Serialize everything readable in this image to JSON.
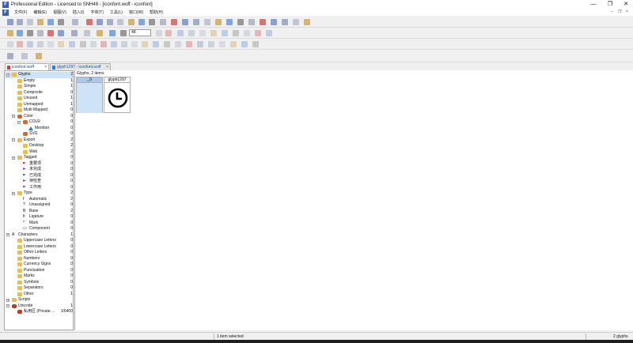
{
  "window": {
    "title": "Professional Edition - Licensed to SNH48 - [iconfont.woff - iconfont]",
    "minimize": "—",
    "maximize": "❐",
    "close": "✕"
  },
  "menubar": {
    "items": [
      "文件(F)",
      "编辑(E)",
      "视图(V)",
      "插入(I)",
      "字体(T)",
      "工具(L)",
      "窗口(W)",
      "帮助(H)"
    ],
    "mdi_controls": [
      "–",
      "❐",
      "×"
    ]
  },
  "toolbar": {
    "zoom_value": "48"
  },
  "tabs": [
    {
      "label": "iconfont.woff",
      "active": true
    },
    {
      "label": "glyph1297 - iconfont.woff",
      "active": false
    }
  ],
  "tree": {
    "items": [
      {
        "label": "Glyphs",
        "count": "2",
        "level": 0,
        "expander": "−",
        "icon": "folder",
        "selected": true
      },
      {
        "label": "Empty",
        "count": "1",
        "level": 1,
        "icon": "folder"
      },
      {
        "label": "Simple",
        "count": "1",
        "level": 1,
        "icon": "folder"
      },
      {
        "label": "Composite",
        "count": "0",
        "level": 1,
        "icon": "folder"
      },
      {
        "label": "Unused",
        "count": "1",
        "level": 1,
        "icon": "folder"
      },
      {
        "label": "Unmapped",
        "count": "1",
        "level": 1,
        "icon": "folder"
      },
      {
        "label": "Multi Mapped",
        "count": "0",
        "level": 1,
        "icon": "folder"
      },
      {
        "label": "Color",
        "count": "0",
        "level": 1,
        "expander": "−",
        "icon": "color"
      },
      {
        "label": "COLR",
        "count": "0",
        "level": 2,
        "expander": "−",
        "icon": "color"
      },
      {
        "label": "Member",
        "count": "0",
        "level": 3,
        "icon": "triangle"
      },
      {
        "label": "SVG",
        "count": "0",
        "level": 2,
        "icon": "color"
      },
      {
        "label": "Export",
        "count": "2",
        "level": 1,
        "expander": "−",
        "icon": "folder"
      },
      {
        "label": "Desktop",
        "count": "2",
        "level": 2,
        "icon": "folder"
      },
      {
        "label": "Web",
        "count": "2",
        "level": 2,
        "icon": "folder"
      },
      {
        "label": "Tagged",
        "count": "0",
        "level": 1,
        "expander": "−",
        "icon": "folder"
      },
      {
        "label": "重要项",
        "count": "0",
        "level": 2,
        "icon": "flag-red"
      },
      {
        "label": "未完成",
        "count": "0",
        "level": 2,
        "icon": "flag-purple"
      },
      {
        "label": "已完成",
        "count": "0",
        "level": 2,
        "icon": "flag-blue"
      },
      {
        "label": "待检查",
        "count": "0",
        "level": 2,
        "icon": "flag-purple"
      },
      {
        "label": "工作用",
        "count": "0",
        "level": 2,
        "icon": "flag-blue"
      },
      {
        "label": "Type",
        "count": "2",
        "level": 1,
        "expander": "−",
        "icon": "folder"
      },
      {
        "label": "Automatic",
        "count": "2",
        "level": 2,
        "icon": "glyph-f"
      },
      {
        "label": "Unassigned",
        "count": "0",
        "level": 2,
        "icon": "glyph-q"
      },
      {
        "label": "Base",
        "count": "2",
        "level": 2,
        "icon": "glyph-b"
      },
      {
        "label": "Ligature",
        "count": "0",
        "level": 2,
        "icon": "glyph-fi"
      },
      {
        "label": "Mark",
        "count": "0",
        "level": 2,
        "icon": "glyph-caret"
      },
      {
        "label": "Component",
        "count": "0",
        "level": 2,
        "icon": "glyph-box"
      },
      {
        "label": "Characters",
        "count": "1",
        "level": 0,
        "expander": "−",
        "icon": "glyph-a"
      },
      {
        "label": "Uppercase Letters",
        "count": "0",
        "level": 1,
        "icon": "folder"
      },
      {
        "label": "Lowercase Letters",
        "count": "0",
        "level": 1,
        "icon": "folder"
      },
      {
        "label": "Other Letters",
        "count": "0",
        "level": 1,
        "icon": "folder"
      },
      {
        "label": "Numbers",
        "count": "0",
        "level": 1,
        "icon": "folder"
      },
      {
        "label": "Currency Signs",
        "count": "0",
        "level": 1,
        "icon": "folder"
      },
      {
        "label": "Punctuation",
        "count": "0",
        "level": 1,
        "icon": "folder"
      },
      {
        "label": "Marks",
        "count": "0",
        "level": 1,
        "icon": "folder"
      },
      {
        "label": "Symbols",
        "count": "0",
        "level": 1,
        "icon": "folder"
      },
      {
        "label": "Separators",
        "count": "0",
        "level": 1,
        "icon": "folder"
      },
      {
        "label": "Other",
        "count": "1",
        "level": 1,
        "icon": "folder"
      },
      {
        "label": "Scripts",
        "count": "",
        "level": 0,
        "expander": "+",
        "icon": "folder"
      },
      {
        "label": "Unicode",
        "count": "1",
        "level": 0,
        "expander": "−",
        "icon": "unicode"
      },
      {
        "label": "私用区 (Private ...",
        "count": "1/6400",
        "level": 1,
        "icon": "unicode"
      }
    ]
  },
  "glyph_view": {
    "header": "Glyphs, 2 items",
    "cells": [
      {
        "name": "_0",
        "selected": true
      },
      {
        "name": "glyph1297",
        "selected": false
      }
    ]
  },
  "statusbar": {
    "selection": "1 item selected",
    "count": "2 glyphs"
  },
  "colors": {
    "selection": "#cfe3f8",
    "tab_text": "#1a52a8",
    "folder": "#e8bf4e"
  }
}
